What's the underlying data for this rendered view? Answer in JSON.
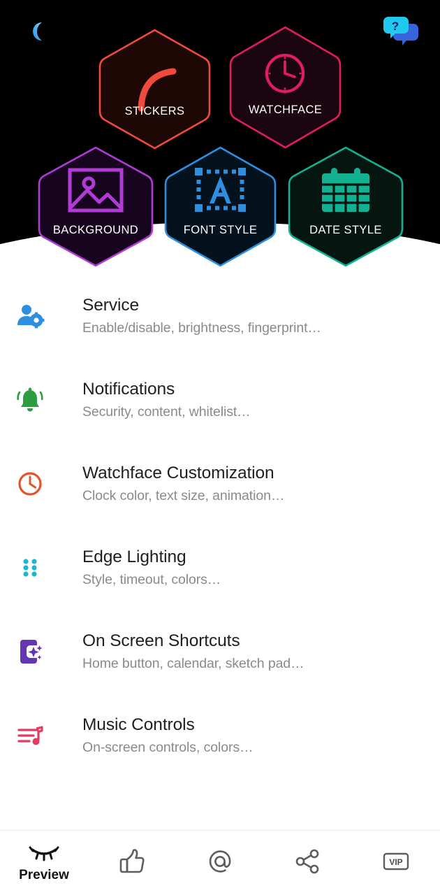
{
  "hero": {
    "moon_icon": "moon-icon",
    "help_icon": "help-chat-icon",
    "help_glyph": "?",
    "tiles": [
      {
        "label": "STICKERS",
        "icon": "sticker-arc-icon",
        "color": "#F04A3C",
        "fill": "#1d0806"
      },
      {
        "label": "WATCHFACE",
        "icon": "clock-icon",
        "color": "#E31B63",
        "fill": "#1b0610"
      },
      {
        "label": "BACKGROUND",
        "icon": "image-icon",
        "color": "#B13BD4",
        "fill": "#170520"
      },
      {
        "label": "FONT STYLE",
        "icon": "font-a-icon",
        "color": "#2E8FE0",
        "fill": "#04121e"
      },
      {
        "label": "DATE STYLE",
        "icon": "calendar-icon",
        "color": "#12B192",
        "fill": "#04160f"
      }
    ]
  },
  "list": {
    "items": [
      {
        "title": "Service",
        "subtitle": "Enable/disable, brightness, fingerprint…",
        "icon": "person-gear-icon",
        "color": "#2E8FE0"
      },
      {
        "title": "Notifications",
        "subtitle": "Security, content, whitelist…",
        "icon": "bell-icon",
        "color": "#2C9E3F"
      },
      {
        "title": "Watchface Customization",
        "subtitle": "Clock color, text size, animation…",
        "icon": "clock-icon",
        "color": "#E5532A"
      },
      {
        "title": "Edge Lighting",
        "subtitle": "Style, timeout, colors…",
        "icon": "dot-grid-icon",
        "color": "#1BB8CE"
      },
      {
        "title": "On Screen Shortcuts",
        "subtitle": "Home button, calendar, sketch pad…",
        "icon": "phone-sparkle-icon",
        "color": "#6236B5"
      },
      {
        "title": "Music Controls",
        "subtitle": "On-screen controls, colors…",
        "icon": "music-playlist-icon",
        "color": "#E23A63"
      }
    ]
  },
  "navbar": {
    "items": [
      {
        "label": "Preview",
        "icon": "closed-eye-icon"
      },
      {
        "label": "",
        "icon": "thumbs-up-icon"
      },
      {
        "label": "",
        "icon": "at-sign-icon"
      },
      {
        "label": "",
        "icon": "share-icon"
      },
      {
        "label": "",
        "icon": "vip-badge-icon"
      }
    ],
    "vip_text": "VIP"
  }
}
